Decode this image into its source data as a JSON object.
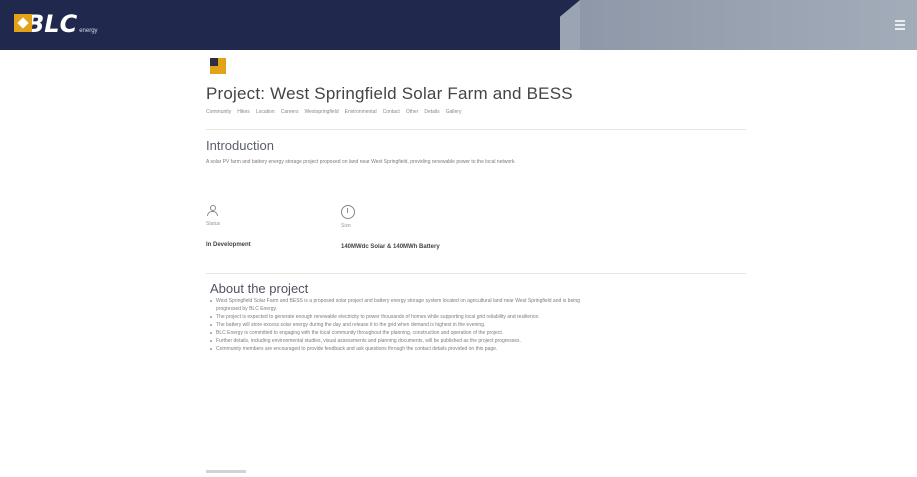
{
  "app": {
    "logo_text": "BLC",
    "logo_sub": "energy"
  },
  "project": {
    "title": "Project: West Springfield Solar Farm and BESS",
    "tags": [
      "Community",
      "Hikes",
      "Location",
      "Careers",
      "Westspringfield",
      "Environmental",
      "Contact",
      "Other",
      "Details",
      "Gallery"
    ],
    "intro_title": "Introduction",
    "intro_text": "A solar PV farm and battery energy storage project proposed on land near West Springfield, providing renewable power to the local network.",
    "status_label": "Status",
    "status_value": "In Development",
    "size_label": "Size",
    "size_value": "140MWdc Solar & 140MWh Battery",
    "about_title": "About the project",
    "about_items": [
      "West Springfield Solar Farm and BESS is a proposed solar project and battery energy storage system located on agricultural land near West Springfield and is being progressed by BLC Energy.",
      "The project is expected to generate enough renewable electricity to power thousands of homes while supporting local grid reliability and resilience.",
      "The battery will store excess solar energy during the day and release it to the grid when demand is highest in the evening.",
      "BLC Energy is committed to engaging with the local community throughout the planning, construction and operation of the project.",
      "Further details, including environmental studies, visual assessments and planning documents, will be published as the project progresses.",
      "Community members are encouraged to provide feedback and ask questions through the contact details provided on this page."
    ]
  }
}
